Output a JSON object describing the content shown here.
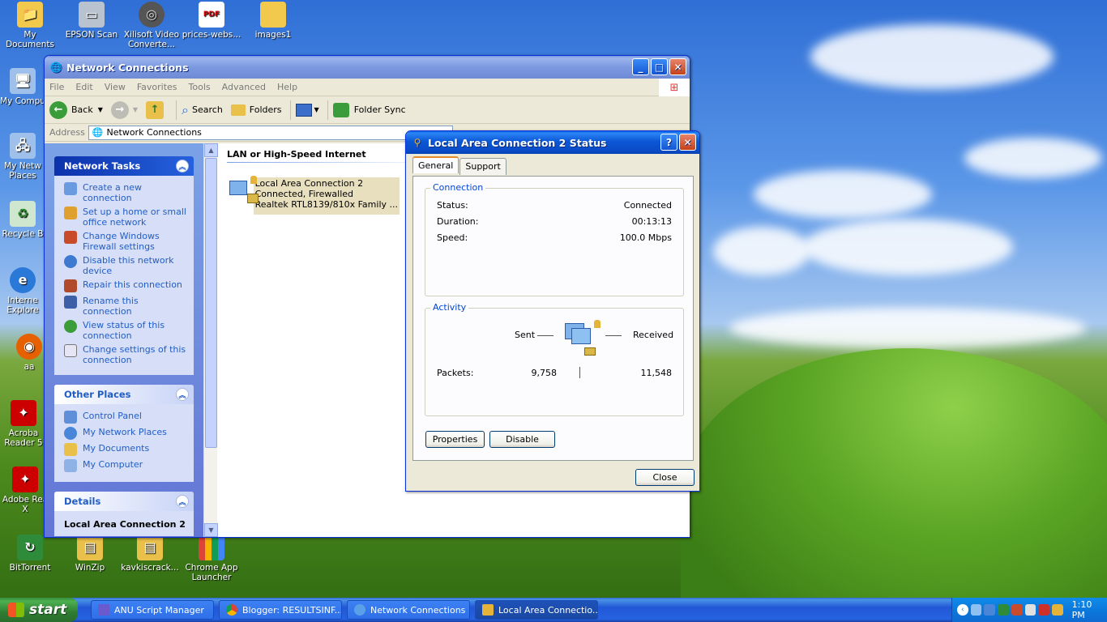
{
  "desktop": {
    "icons": [
      {
        "label": "My Documents"
      },
      {
        "label": "EPSON Scan"
      },
      {
        "label": "Xilisoft Video Converte..."
      },
      {
        "label": "prices-webs..."
      },
      {
        "label": "images1"
      },
      {
        "label": "My Compu"
      },
      {
        "label": "My Netw Places"
      },
      {
        "label": "Recycle B"
      },
      {
        "label": "Interne Explore"
      },
      {
        "label": "aa"
      },
      {
        "label": "Acroba Reader 5"
      },
      {
        "label": "Adobe Rea X"
      },
      {
        "label": "BitTorrent"
      },
      {
        "label": "WinZip"
      },
      {
        "label": "kavkiscrack..."
      },
      {
        "label": "Chrome App Launcher"
      }
    ]
  },
  "explorer": {
    "title": "Network Connections",
    "menu": [
      "File",
      "Edit",
      "View",
      "Favorites",
      "Tools",
      "Advanced",
      "Help"
    ],
    "toolbar": {
      "back": "Back",
      "search": "Search",
      "folders": "Folders",
      "folder_sync": "Folder Sync"
    },
    "address": {
      "label": "Address",
      "value": "Network Connections"
    },
    "network_tasks": {
      "title": "Network Tasks",
      "items": [
        "Create a new connection",
        "Set up a home or small office network",
        "Change Windows Firewall settings",
        "Disable this network device",
        "Repair this connection",
        "Rename this connection",
        "View status of this connection",
        "Change settings of this connection"
      ]
    },
    "other_places": {
      "title": "Other Places",
      "items": [
        "Control Panel",
        "My Network Places",
        "My Documents",
        "My Computer"
      ]
    },
    "details": {
      "title": "Details",
      "name": "Local Area Connection 2"
    },
    "group_header": "LAN or High-Speed Internet",
    "connection": {
      "name": "Local Area Connection 2",
      "status": "Connected, Firewalled",
      "device": "Realtek RTL8139/810x Family ..."
    }
  },
  "dialog": {
    "title": "Local Area Connection 2 Status",
    "tabs": [
      "General",
      "Support"
    ],
    "connection_group": "Connection",
    "status_label": "Status:",
    "status_value": "Connected",
    "duration_label": "Duration:",
    "duration_value": "00:13:13",
    "speed_label": "Speed:",
    "speed_value": "100.0 Mbps",
    "activity_group": "Activity",
    "sent_label": "Sent",
    "received_label": "Received",
    "packets_label": "Packets:",
    "packets_sent": "9,758",
    "packets_received": "11,548",
    "properties_btn": "Properties",
    "disable_btn": "Disable",
    "close_btn": "Close"
  },
  "taskbar": {
    "start": "start",
    "items": [
      "ANU Script Manager",
      "Blogger: RESULTSINF...",
      "Network Connections",
      "Local Area Connectio..."
    ],
    "clock": "1:10 PM"
  },
  "colors": {
    "link": "#215dc6",
    "titlebar": "#0a4cc7",
    "group_title": "#0046d5"
  }
}
